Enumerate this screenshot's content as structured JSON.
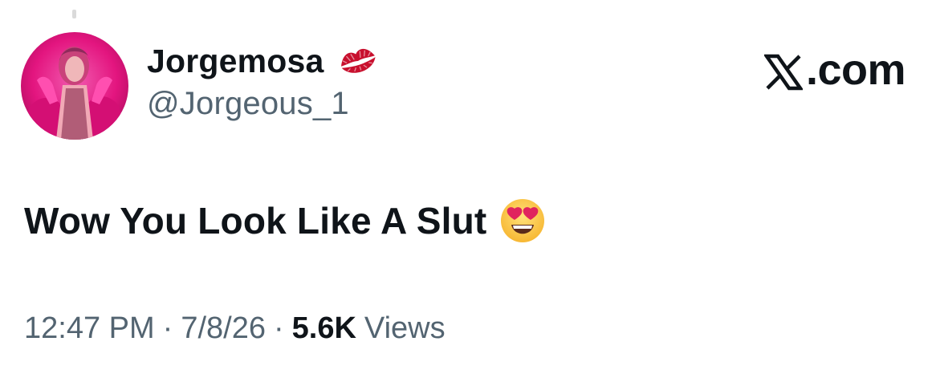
{
  "tweet": {
    "author": {
      "display_name": "Jorgemosa",
      "handle": "@Jorgeous_1",
      "name_icon": "kiss-mark-icon",
      "avatar": "avatar"
    },
    "brand": {
      "logo_icon": "x-logo-icon",
      "label": ".com"
    },
    "text": "Wow You Look Like A Slut",
    "text_icon": "heart-eyes-emoji-icon",
    "meta": {
      "time": "12:47 PM",
      "separator": "·",
      "date": "7/8/26",
      "views_count": "5.6K",
      "views_label": "Views"
    }
  },
  "colors": {
    "text_primary": "#0f1419",
    "text_secondary": "#536471",
    "avatar_accent": "#e3157f",
    "background": "#ffffff"
  }
}
